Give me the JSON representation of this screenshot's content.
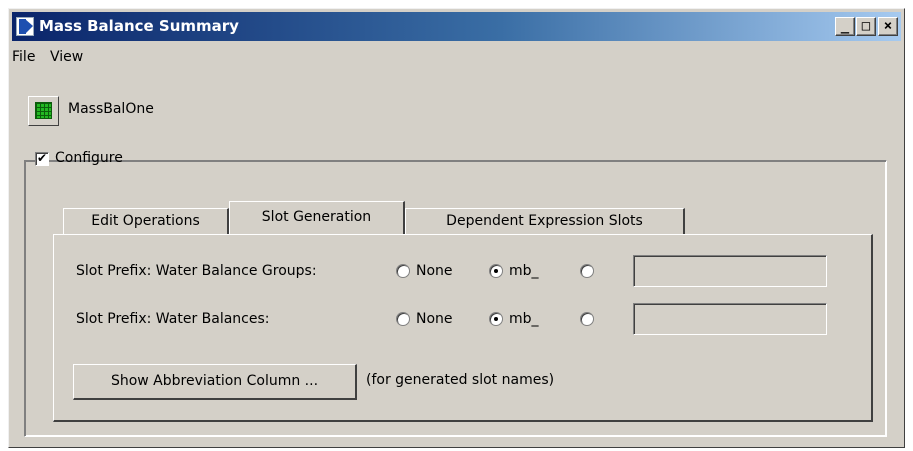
{
  "window": {
    "title": "Mass Balance Summary",
    "controls": {
      "minimize": "_",
      "maximize": "□",
      "close": "×"
    }
  },
  "menu": {
    "items": [
      "File",
      "View"
    ]
  },
  "object": {
    "name": "MassBalOne",
    "icon": "grid-table-icon"
  },
  "configure": {
    "label": "Configure",
    "checked": true,
    "check_glyph": "✔"
  },
  "tabs": [
    {
      "label": "Edit Operations",
      "active": false
    },
    {
      "label": "Slot Generation",
      "active": true
    },
    {
      "label": "Dependent Expression Slots",
      "active": false
    }
  ],
  "slot_generation": {
    "rows": [
      {
        "label": "Slot Prefix: Water Balance Groups:",
        "options": [
          "None",
          "mb_",
          ""
        ],
        "selected": "mb_",
        "custom_value": ""
      },
      {
        "label": "Slot Prefix: Water Balances:",
        "options": [
          "None",
          "mb_",
          ""
        ],
        "selected": "mb_",
        "custom_value": ""
      }
    ],
    "abbreviation_button": "Show Abbreviation Column ...",
    "abbreviation_note": "(for generated slot names)"
  }
}
